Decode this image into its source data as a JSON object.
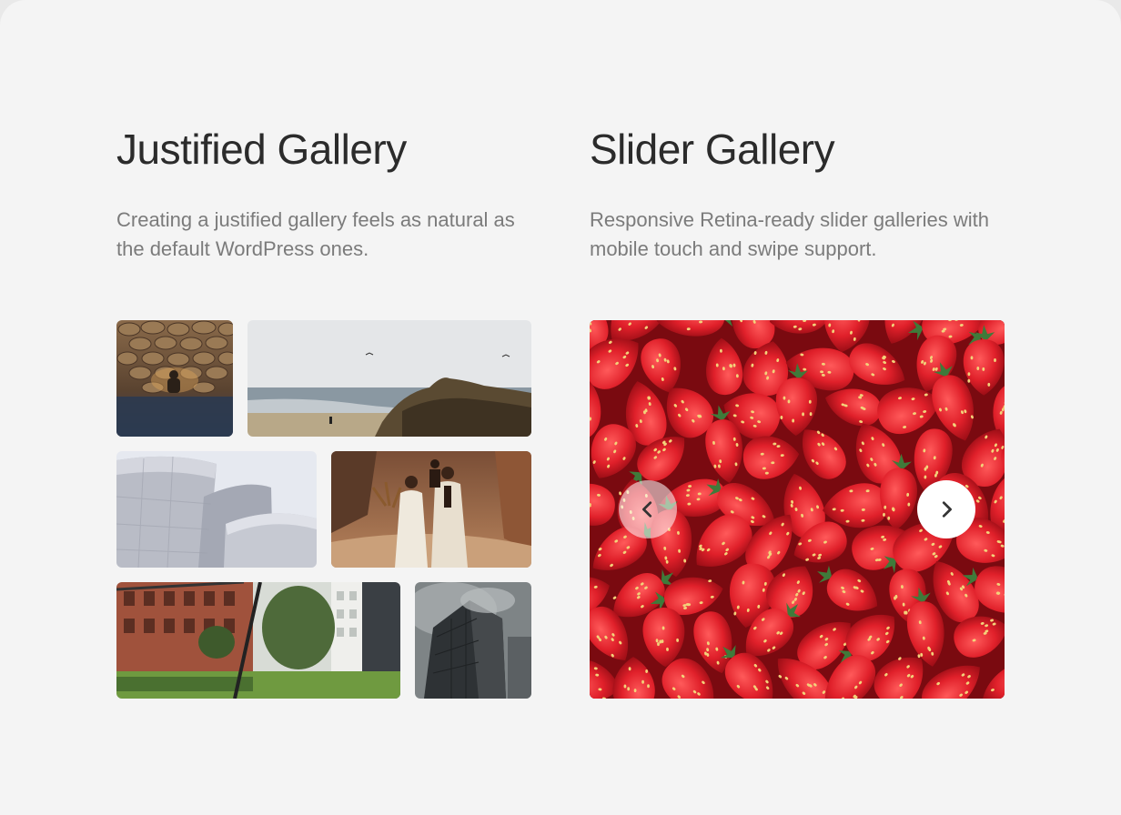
{
  "justified": {
    "title": "Justified Gallery",
    "description": "Creating a justified gallery feels as natural as the default WordPress ones.",
    "images": [
      "stone-wall-shadow",
      "beach-rocks",
      "metal-architecture",
      "wedding-couple",
      "city-street",
      "foggy-tower"
    ]
  },
  "slider": {
    "title": "Slider Gallery",
    "description": "Responsive Retina-ready slider galleries with mobile touch and swipe support.",
    "image": "strawberries",
    "prev_icon": "chevron-left-icon",
    "next_icon": "chevron-right-icon"
  },
  "colors": {
    "background": "#f4f4f4",
    "title": "#2b2b2b",
    "description": "#7b7b7b"
  }
}
